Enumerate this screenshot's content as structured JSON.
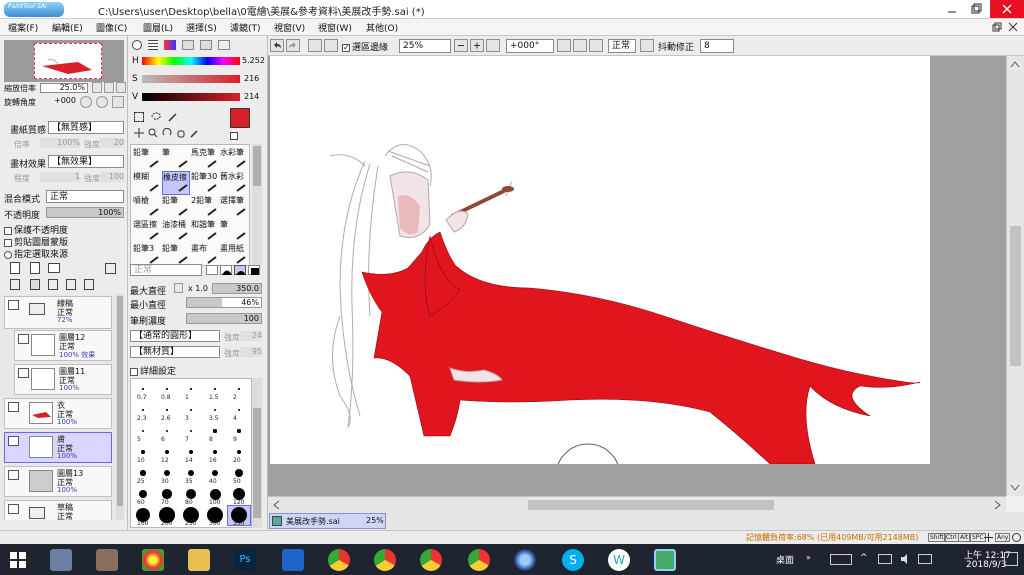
{
  "title": {
    "app_logo": "PaintTool SAI",
    "path": "C:\\Users\\user\\Desktop\\bella\\0電繪\\美展&參考資料\\美展改手勢.sai (*)"
  },
  "menu": [
    "檔案(F)",
    "編輯(E)",
    "圖像(C)",
    "圖層(L)",
    "選擇(S)",
    "濾鏡(T)",
    "視窗(V)",
    "視窗(W)",
    "其他(O)"
  ],
  "toolbar": {
    "selection_edge_label": "選區邊緣",
    "zoom": "25%",
    "rotation": "+000°",
    "blend_mode": "正常",
    "stabilizer_label": "抖動修正",
    "stabilizer_value": "8"
  },
  "navigator": {
    "zoom_label": "縮放倍率",
    "zoom_value": "25.0%",
    "rotate_label": "旋轉角度",
    "rotate_value": "+000"
  },
  "paper": {
    "texture_label": "畫紙質感",
    "texture_value": "【無質感】",
    "scale_label": "倍率",
    "scale_value": "100%",
    "strength_label": "強度",
    "strength_value": "20",
    "effect_label": "畫材效果",
    "effect_value": "【無效果】",
    "degree_label": "程度",
    "degree_value": "1",
    "strength2_value": "100"
  },
  "layer_props": {
    "blend_label": "混合模式",
    "blend_value": "正常",
    "opacity_label": "不透明度",
    "opacity_value": "100%",
    "opts": [
      "保護不透明度",
      "剪貼圖層蒙版",
      "指定選取來源"
    ]
  },
  "layers": [
    {
      "name": "線稿",
      "mode": "正常",
      "opacity": "72%",
      "folder": true
    },
    {
      "name": "圖層12",
      "mode": "正常",
      "opacity": "100% 效果"
    },
    {
      "name": "圖層11",
      "mode": "正常",
      "opacity": "100%"
    },
    {
      "name": "衣",
      "mode": "正常",
      "opacity": "100%"
    },
    {
      "name": "膚",
      "mode": "正常",
      "opacity": "100%",
      "selected": true
    },
    {
      "name": "圖層13",
      "mode": "正常",
      "opacity": "100%"
    },
    {
      "name": "草稿",
      "mode": "正常",
      "opacity": ""
    }
  ],
  "color": {
    "h_value": "5.252",
    "s_value": "216",
    "v_value": "214",
    "fg": "#d8202a"
  },
  "brushes": [
    [
      "鉛筆",
      "筆",
      "馬克筆",
      "水彩筆"
    ],
    [
      "模糊",
      "橡皮擦",
      "鉛筆30",
      "舊水彩"
    ],
    [
      "噴槍",
      "鉛筆",
      "2鉛筆",
      "選擇筆"
    ],
    [
      "選區擦",
      "油漆桶",
      "和諧筆",
      "筆"
    ],
    [
      "鉛筆3",
      "鉛筆",
      "畫布",
      "畫用紙"
    ]
  ],
  "brush_opts": {
    "mode": "正常",
    "max_size_label": "最大直徑",
    "max_size_mult": "x 1.0",
    "max_size_value": "350.0",
    "min_size_label": "最小直徑",
    "min_size_value": "46%",
    "density_label": "筆刷濃度",
    "density_value": "100",
    "shape": "【通常的圓形】",
    "shape_strength_label": "強度",
    "shape_strength": "24",
    "texture": "【無材質】",
    "texture_strength": "95",
    "advanced_label": "詳細設定"
  },
  "brush_sizes": [
    "0.7",
    "0.8",
    "1",
    "1.5",
    "2",
    "2.3",
    "2.6",
    "3",
    "3.5",
    "4",
    "5",
    "6",
    "7",
    "8",
    "9",
    "10",
    "12",
    "14",
    "16",
    "20",
    "25",
    "30",
    "35",
    "40",
    "50",
    "60",
    "70",
    "80",
    "100",
    "120",
    "160",
    "200",
    "250",
    "300",
    "350"
  ],
  "doc_tab": {
    "name": "美展改手勢.sai",
    "zoom": "25%"
  },
  "status": {
    "memory": "記憶體負荷率:68% (已用409MB/可用2148MB)",
    "keys": [
      "Shift",
      "Ctrl",
      "Alt",
      "SPC",
      "Any"
    ]
  },
  "taskbar": {
    "desktop_label": "桌面",
    "time": "上午 12:17",
    "date": "2018/9/3"
  }
}
